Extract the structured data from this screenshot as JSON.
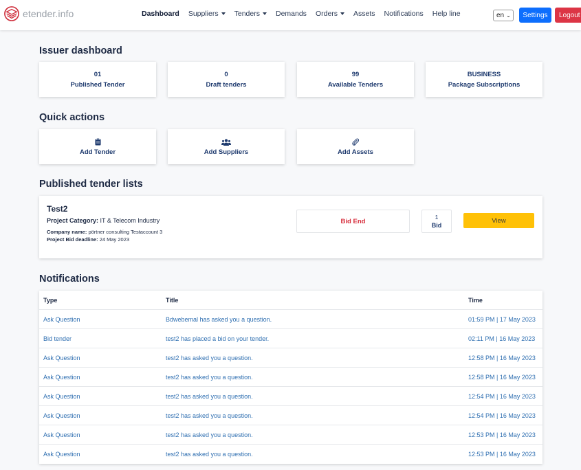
{
  "brand": {
    "name": "etender.info"
  },
  "nav": {
    "items": [
      {
        "label": "Dashboard",
        "active": true,
        "dropdown": false
      },
      {
        "label": "Suppliers",
        "active": false,
        "dropdown": true
      },
      {
        "label": "Tenders",
        "active": false,
        "dropdown": true
      },
      {
        "label": "Demands",
        "active": false,
        "dropdown": false
      },
      {
        "label": "Orders",
        "active": false,
        "dropdown": true
      },
      {
        "label": "Assets",
        "active": false,
        "dropdown": false
      },
      {
        "label": "Notifications",
        "active": false,
        "dropdown": false
      },
      {
        "label": "Help line",
        "active": false,
        "dropdown": false
      }
    ],
    "language": "en",
    "settings_label": "Settings",
    "logout_label": "Logout"
  },
  "dashboard": {
    "title": "Issuer dashboard",
    "stats": [
      {
        "value": "01",
        "label": "Published Tender"
      },
      {
        "value": "0",
        "label": "Draft tenders"
      },
      {
        "value": "99",
        "label": "Available Tenders"
      },
      {
        "value": "BUSINESS",
        "label": "Package Subscriptions"
      }
    ]
  },
  "quick_actions": {
    "title": "Quick actions",
    "items": [
      {
        "icon": "clipboard-icon",
        "label": "Add Tender"
      },
      {
        "icon": "users-icon",
        "label": "Add Suppliers"
      },
      {
        "icon": "paperclip-icon",
        "label": "Add Assets"
      }
    ]
  },
  "published": {
    "title": "Published tender lists",
    "tender": {
      "name": "Test2",
      "category_label": "Project Category:",
      "category": "IT & Telecom Industry",
      "company_label": "Company name:",
      "company": "pörtner consulting Testaccount 3",
      "deadline_label": "Project Bid deadline:",
      "deadline": "24 May 2023",
      "status": "Bid End",
      "bid_count": "1",
      "bid_label": "Bid",
      "view_label": "View"
    }
  },
  "notifications": {
    "title": "Notifications",
    "headers": {
      "type": "Type",
      "title": "Title",
      "time": "Time"
    },
    "rows": [
      {
        "type": "Ask Question",
        "title": "Bdwebemal has asked you a question.",
        "time": "01:59 PM | 17 May 2023"
      },
      {
        "type": "Bid tender",
        "title": "test2 has placed a bid on your tender.",
        "time": "02:11 PM | 16 May 2023"
      },
      {
        "type": "Ask Question",
        "title": "test2 has asked you a question.",
        "time": "12:58 PM | 16 May 2023"
      },
      {
        "type": "Ask Question",
        "title": "test2 has asked you a question.",
        "time": "12:58 PM | 16 May 2023"
      },
      {
        "type": "Ask Question",
        "title": "test2 has asked you a question.",
        "time": "12:54 PM | 16 May 2023"
      },
      {
        "type": "Ask Question",
        "title": "test2 has asked you a question.",
        "time": "12:54 PM | 16 May 2023"
      },
      {
        "type": "Ask Question",
        "title": "test2 has asked you a question.",
        "time": "12:53 PM | 16 May 2023"
      },
      {
        "type": "Ask Question",
        "title": "test2 has asked you a question.",
        "time": "12:53 PM | 16 May 2023"
      }
    ]
  },
  "colors": {
    "primary": "#0d6efd",
    "danger": "#dc3545",
    "warning": "#ffc107",
    "link": "#2f6fb1",
    "heading": "#1e2a44"
  }
}
